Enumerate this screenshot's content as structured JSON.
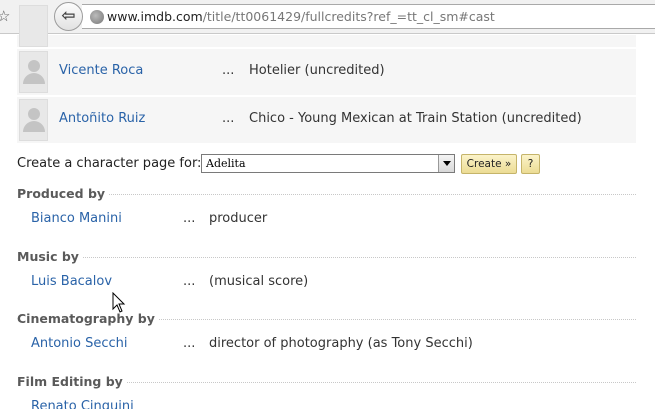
{
  "browser": {
    "url_domain": "www.imdb.com",
    "url_path": "/title/tt0061429/fullcredits?ref_=tt_cl_sm#cast"
  },
  "cast": [
    {
      "name": "Vicente Roca",
      "ellipsis": "...",
      "character": "Hotelier (uncredited)"
    },
    {
      "name": "Antoñito Ruiz",
      "ellipsis": "...",
      "character": "Chico - Young Mexican at Train Station (uncredited)"
    }
  ],
  "character_page": {
    "label": "Create a character page for:",
    "selected": "Adelita",
    "create_label": "Create »",
    "help_label": "?"
  },
  "sections": [
    {
      "heading": "Produced by",
      "name": "Bianco Manini",
      "dots": "...",
      "role": "producer"
    },
    {
      "heading": "Music by",
      "name": "Luis Bacalov",
      "dots": "...",
      "role": "(musical score)"
    },
    {
      "heading": "Cinematography by",
      "name": "Antonio Secchi",
      "dots": "...",
      "role": "director of photography (as Tony Secchi)"
    },
    {
      "heading": "Film Editing by",
      "name": "Renato Cinquini",
      "dots": "",
      "role": ""
    }
  ]
}
